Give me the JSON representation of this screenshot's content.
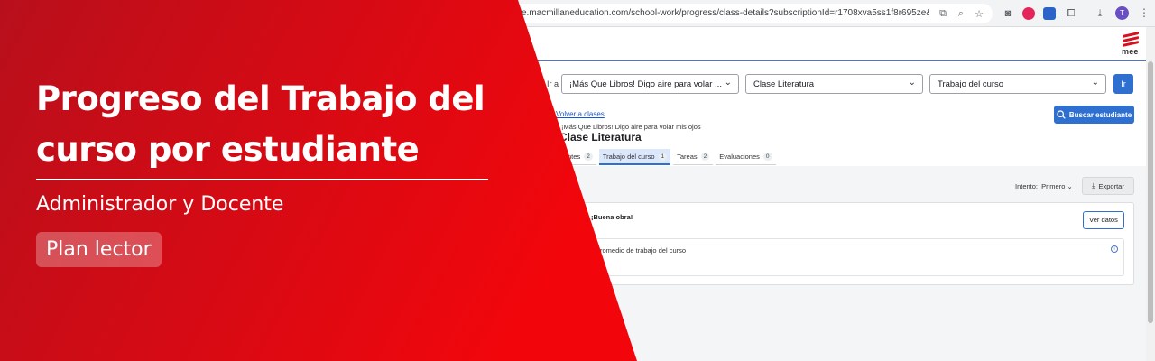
{
  "browser": {
    "url": "e.macmillaneducation.com/school-work/progress/class-details?subscriptionId=r1708xva5ss1f8r695ze&courseNa...",
    "avatar_initial": "T"
  },
  "app": {
    "logo_text": "mee",
    "filters": {
      "prefix": "Ir a",
      "book": "¡Más Que Libros! Digo aire para volar ...",
      "class": "Clase Literatura",
      "section": "Trabajo del curso",
      "go_label": "Ir"
    },
    "back_link": "Volver a clases",
    "book_line": "¡Más Que Libros! Digo aire para volar mis ojos",
    "class_title": "Clase Literatura",
    "search_button": "Buscar estudiante",
    "tabs": [
      {
        "label": "Estudiantes",
        "count": "2",
        "active": false
      },
      {
        "label": "Trabajo del curso",
        "count": "1",
        "active": true
      },
      {
        "label": "Tareas",
        "count": "2",
        "active": false
      },
      {
        "label": "Evaluaciones",
        "count": "0",
        "active": false
      }
    ],
    "attempt_label": "Intento:",
    "attempt_value": "Primero",
    "export_label": "Exportar",
    "card_title": "¡Buena obra!",
    "view_button": "Ver datos",
    "avg_text": "Promedio de trabajo del curso"
  },
  "banner": {
    "title_line1": "Progreso del Trabajo del",
    "title_line2": "curso por estudiante",
    "subtitle": "Administrador y Docente",
    "pill": "Plan lector",
    "colors": {
      "red_light": "#f2060c",
      "red_dark": "#b80f1c"
    }
  }
}
